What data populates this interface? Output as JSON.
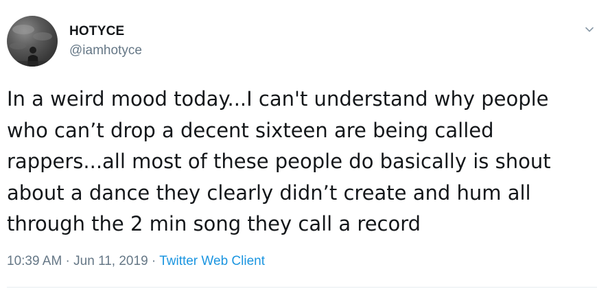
{
  "author": {
    "display_name": "HOTYCE",
    "handle": "@iamhotyce"
  },
  "tweet": {
    "lines": [
      "In a weird mood today...I can't understand why people",
      "who can’t drop a decent sixteen are being called",
      "rappers...all most of these people do basically is shout",
      "about a dance they clearly didn’t create and hum all",
      "through the 2 min song they call a record"
    ]
  },
  "meta": {
    "time": "10:39 AM",
    "separator": " · ",
    "date": "Jun 11, 2019",
    "source": "Twitter Web Client"
  },
  "icons": {
    "menu": "chevron-down-icon"
  },
  "colors": {
    "text": "#14171a",
    "secondary": "#657786",
    "link": "#1b95e0",
    "divider": "#e6ecf0"
  }
}
